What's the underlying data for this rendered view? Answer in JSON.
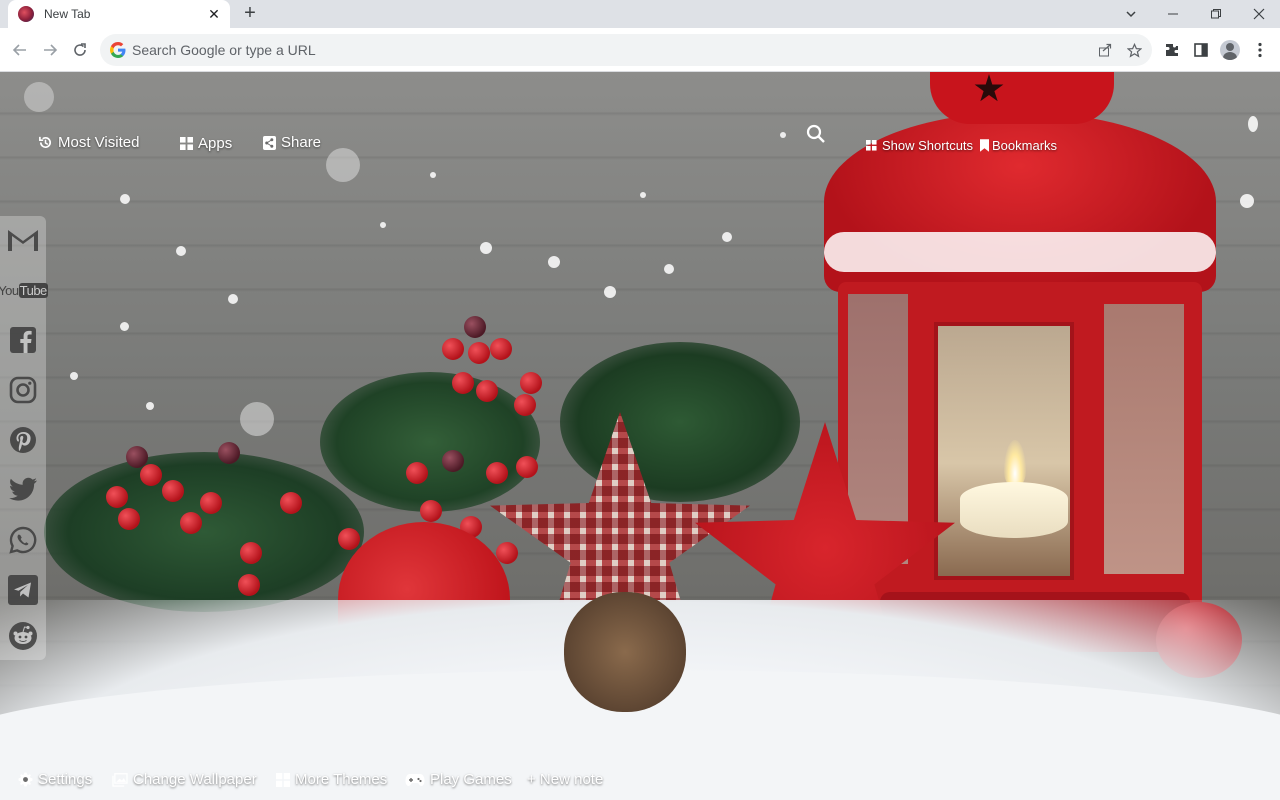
{
  "browser": {
    "tab": {
      "title": "New Tab",
      "close_icon": "close-icon"
    },
    "new_tab_symbol": "+",
    "omnibox": {
      "placeholder": "Search Google or type a URL",
      "value": ""
    }
  },
  "overlay": {
    "top_left": [
      {
        "label": "Most Visited",
        "icon": "history-icon"
      },
      {
        "label": "Apps",
        "icon": "grid-icon"
      },
      {
        "label": "Share",
        "icon": "share-icon"
      }
    ],
    "top_right": {
      "search_icon": "search-icon",
      "show_shortcuts": "Show Shortcuts",
      "bookmarks": "Bookmarks"
    },
    "sidebar": [
      "gmail-icon",
      "youtube-icon",
      "facebook-icon",
      "instagram-icon",
      "pinterest-icon",
      "twitter-icon",
      "whatsapp-icon",
      "telegram-icon",
      "reddit-icon"
    ],
    "youtube_text": {
      "you": "You",
      "tube": "Tube"
    },
    "bottom": [
      {
        "label": "Settings",
        "icon": "gear-icon"
      },
      {
        "label": "Change Wallpaper",
        "icon": "image-icon"
      },
      {
        "label": "More Themes",
        "icon": "windows-icon"
      },
      {
        "label": "Play Games",
        "icon": "gamepad-icon"
      },
      {
        "label": "+ New note",
        "icon": ""
      }
    ]
  },
  "colors": {
    "accent_red": "#c8141c",
    "tabstrip": "#dee1e6",
    "omnibox_bg": "#f1f3f4"
  }
}
